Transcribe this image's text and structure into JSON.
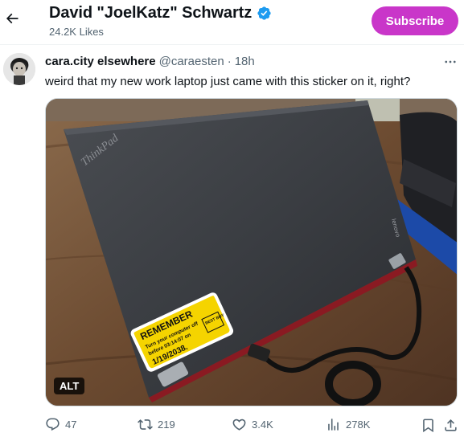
{
  "header": {
    "name": "David \"JoelKatz\" Schwartz",
    "likes": "24.2K Likes",
    "subscribe_label": "Subscribe",
    "accent_color": "#c936c9",
    "verified_color": "#1d9bf0"
  },
  "tweet": {
    "display_name": "cara.city elsewhere",
    "handle": "@caraesten",
    "separator": "·",
    "time": "18h",
    "text": "weird that my new work laptop just came with this sticker on it, right?",
    "media": {
      "laptop_brand": "ThinkPad",
      "hinge_label": "lenovo",
      "sticker": {
        "heading": "REMEMBER",
        "line1": "Turn your computer off",
        "line2": "before 03:14:07 on",
        "date": "1/19/2038.",
        "badge": "BEST BUY"
      },
      "alt_label": "ALT"
    }
  },
  "actions": {
    "replies": "47",
    "reposts": "219",
    "likes": "3.4K",
    "views": "278K"
  }
}
